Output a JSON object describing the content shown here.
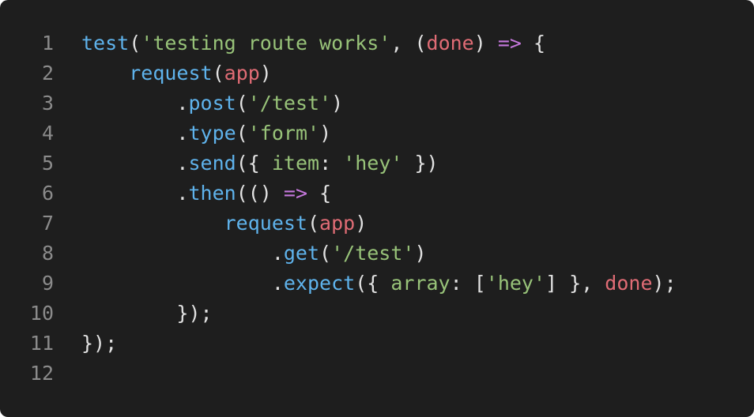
{
  "colors": {
    "background": "#1e1e1e",
    "line_number": "#8b8b8b",
    "function": "#5fb3ec",
    "string": "#98c379",
    "variable": "#e06c75",
    "operator": "#c678dd",
    "punctuation": "#e2e2e2"
  },
  "lines": [
    {
      "n": "1",
      "tokens": [
        {
          "t": "test",
          "c": "fn"
        },
        {
          "t": "(",
          "c": "p"
        },
        {
          "t": "'testing route works'",
          "c": "str"
        },
        {
          "t": ", (",
          "c": "p"
        },
        {
          "t": "done",
          "c": "var"
        },
        {
          "t": ") ",
          "c": "p"
        },
        {
          "t": "=>",
          "c": "op"
        },
        {
          "t": " {",
          "c": "p"
        }
      ]
    },
    {
      "n": "2",
      "tokens": [
        {
          "t": "    ",
          "c": "p"
        },
        {
          "t": "request",
          "c": "fn"
        },
        {
          "t": "(",
          "c": "p"
        },
        {
          "t": "app",
          "c": "var"
        },
        {
          "t": ")",
          "c": "p"
        }
      ]
    },
    {
      "n": "3",
      "tokens": [
        {
          "t": "        .",
          "c": "p"
        },
        {
          "t": "post",
          "c": "fn"
        },
        {
          "t": "(",
          "c": "p"
        },
        {
          "t": "'/test'",
          "c": "str"
        },
        {
          "t": ")",
          "c": "p"
        }
      ]
    },
    {
      "n": "4",
      "tokens": [
        {
          "t": "        .",
          "c": "p"
        },
        {
          "t": "type",
          "c": "fn"
        },
        {
          "t": "(",
          "c": "p"
        },
        {
          "t": "'form'",
          "c": "str"
        },
        {
          "t": ")",
          "c": "p"
        }
      ]
    },
    {
      "n": "5",
      "tokens": [
        {
          "t": "        .",
          "c": "p"
        },
        {
          "t": "send",
          "c": "fn"
        },
        {
          "t": "({ ",
          "c": "p"
        },
        {
          "t": "item",
          "c": "id"
        },
        {
          "t": ": ",
          "c": "p"
        },
        {
          "t": "'hey'",
          "c": "str"
        },
        {
          "t": " })",
          "c": "p"
        }
      ]
    },
    {
      "n": "6",
      "tokens": [
        {
          "t": "        .",
          "c": "p"
        },
        {
          "t": "then",
          "c": "fn"
        },
        {
          "t": "(() ",
          "c": "p"
        },
        {
          "t": "=>",
          "c": "op"
        },
        {
          "t": " {",
          "c": "p"
        }
      ]
    },
    {
      "n": "7",
      "tokens": [
        {
          "t": "            ",
          "c": "p"
        },
        {
          "t": "request",
          "c": "fn"
        },
        {
          "t": "(",
          "c": "p"
        },
        {
          "t": "app",
          "c": "var"
        },
        {
          "t": ")",
          "c": "p"
        }
      ]
    },
    {
      "n": "8",
      "tokens": [
        {
          "t": "                .",
          "c": "p"
        },
        {
          "t": "get",
          "c": "fn"
        },
        {
          "t": "(",
          "c": "p"
        },
        {
          "t": "'/test'",
          "c": "str"
        },
        {
          "t": ")",
          "c": "p"
        }
      ]
    },
    {
      "n": "9",
      "tokens": [
        {
          "t": "                .",
          "c": "p"
        },
        {
          "t": "expect",
          "c": "fn"
        },
        {
          "t": "({ ",
          "c": "p"
        },
        {
          "t": "array",
          "c": "id"
        },
        {
          "t": ": [",
          "c": "p"
        },
        {
          "t": "'hey'",
          "c": "str"
        },
        {
          "t": "] }, ",
          "c": "p"
        },
        {
          "t": "done",
          "c": "var"
        },
        {
          "t": ");",
          "c": "p"
        }
      ]
    },
    {
      "n": "10",
      "tokens": [
        {
          "t": "        });",
          "c": "p"
        }
      ]
    },
    {
      "n": "11",
      "tokens": [
        {
          "t": "});",
          "c": "p"
        }
      ]
    },
    {
      "n": "12",
      "tokens": []
    }
  ]
}
